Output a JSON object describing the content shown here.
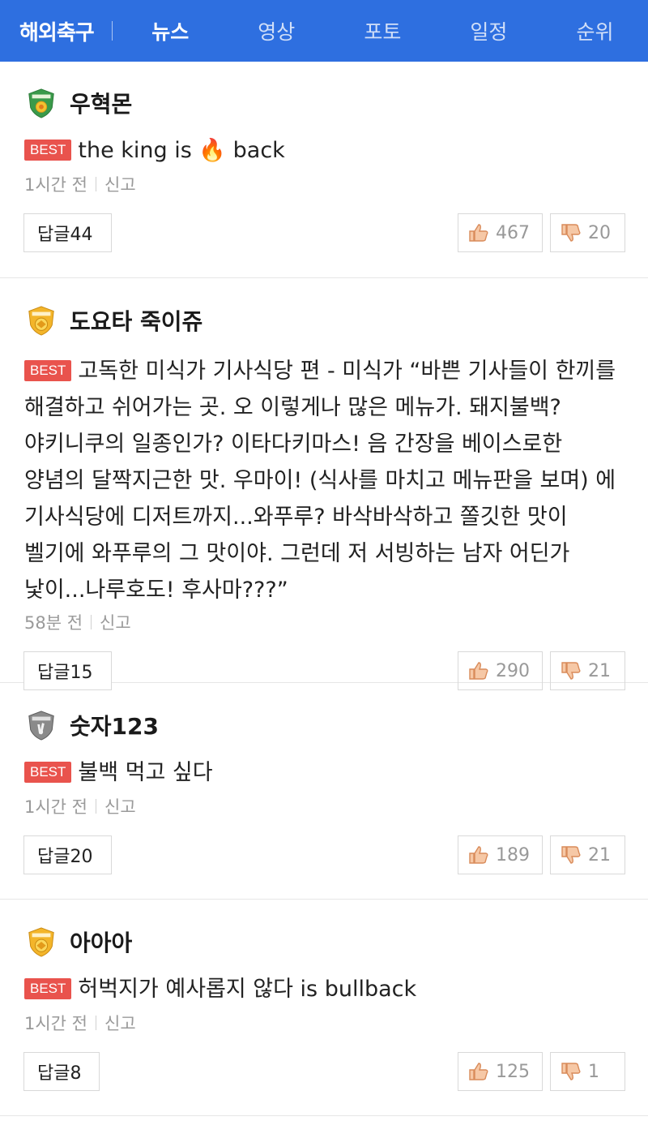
{
  "header": {
    "brand": "해외축구",
    "tabs": [
      "뉴스",
      "영상",
      "포토",
      "일정",
      "순위"
    ],
    "active_tab": "뉴스",
    "bg_color": "#2e6fe0"
  },
  "best_label": "BEST",
  "report_label": "신고",
  "reply_prefix": "답글",
  "comments": [
    {
      "username": "우혁몬",
      "badge": "amateur-badge-icon",
      "text_before": "the king is ",
      "emoji": "🔥",
      "text_after": " back",
      "time": "1시간 전",
      "replies": "답글44",
      "likes": "467",
      "dislikes": "20"
    },
    {
      "username": "도요타 죽이쥬",
      "badge": "master-badge-icon",
      "text": "고독한 미식가 기사식당 편 - 미식가 “바쁜 기사들이 한끼를 해결하고 쉬어가는 곳. 오 이렇게나 많은 메뉴가. 돼지불백? 야키니쿠의 일종인가? 이타다키마스! 음 간장을 베이스로한 양념의 달짝지근한 맛. 우마이! (식사를 마치고 메뉴판을 보며) 에 기사식당에 디저트까지...와푸루? 바삭바삭하고 쫄깃한 맛이 벨기에 와푸루의 그 맛이야. 그런데 저 서빙하는 남자 어딘가 낯이...나루호도! 후사마???”",
      "time": "58분 전",
      "replies": "답글15",
      "likes": "290",
      "dislikes": "21"
    },
    {
      "username": "숫자123",
      "badge": "rookie-badge-icon",
      "text": "불백 먹고 싶다",
      "time": "1시간 전",
      "replies": "답글20",
      "likes": "189",
      "dislikes": "21"
    },
    {
      "username": "아아아",
      "badge": "master-badge-icon",
      "text": "허벅지가 예사롭지 않다 is bullback",
      "time": "1시간 전",
      "replies": "답글8",
      "likes": "125",
      "dislikes": "1"
    }
  ]
}
